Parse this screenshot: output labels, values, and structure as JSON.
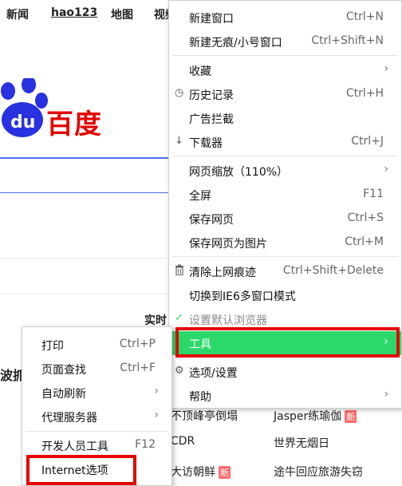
{
  "background": {
    "nav": [
      "新闻",
      "hao123",
      "地图",
      "视频"
    ],
    "logo_text": "百度",
    "logo_paw_text": "du",
    "realtime_label": "实时",
    "cut_text": "波抓",
    "hot_list": [
      {
        "left": "不顶峰亭倒塌",
        "right": "Jasper练瑜伽",
        "right_badge": "新"
      },
      {
        "left": "CDR",
        "right": "世界无烟日",
        "right_badge": ""
      },
      {
        "left": "大访朝鲜",
        "left_badge": "新",
        "right": "途牛回应旅游失窃",
        "right_badge": ""
      }
    ]
  },
  "main_menu": {
    "items": [
      {
        "label": "新建窗口",
        "shortcut": "Ctrl+N"
      },
      {
        "label": "新建无痕/小号窗口",
        "shortcut": "Ctrl+Shift+N"
      },
      {
        "label": "收藏",
        "arrow": "›"
      },
      {
        "label": "历史记录",
        "shortcut": "Ctrl+H",
        "icon": "clock-icon"
      },
      {
        "label": "广告拦截"
      },
      {
        "label": "下载器",
        "shortcut": "Ctrl+J",
        "icon": "download-arrow-icon"
      },
      {
        "label": "网页缩放（110%）",
        "arrow": "›"
      },
      {
        "label": "全屏",
        "shortcut": "F11"
      },
      {
        "label": "保存网页",
        "shortcut": "Ctrl+S"
      },
      {
        "label": "保存网页为图片",
        "shortcut": "Ctrl+M"
      },
      {
        "label": "清除上网痕迹",
        "shortcut": "Ctrl+Shift+Delete",
        "icon": "trash-icon"
      },
      {
        "label": "切换到IE6多窗口模式"
      },
      {
        "label": "设置默认浏览器",
        "icon": "check-icon"
      },
      {
        "label": "工具",
        "arrow": "›"
      },
      {
        "label": "选项/设置",
        "icon": "gear-icon"
      },
      {
        "label": "帮助",
        "arrow": "›"
      }
    ]
  },
  "tools_submenu": {
    "items": [
      {
        "label": "打印",
        "shortcut": "Ctrl+P"
      },
      {
        "label": "页面查找",
        "shortcut": "Ctrl+F"
      },
      {
        "label": "自动刷新",
        "arrow": "›"
      },
      {
        "label": "代理服务器",
        "arrow": "›"
      },
      {
        "label": "开发人员工具",
        "shortcut": "F12"
      },
      {
        "label": "Internet选项"
      }
    ]
  },
  "colors": {
    "highlight": "#2bd96b",
    "annotation_red": "#e60000",
    "baidu_red": "#e10602",
    "baidu_blue": "#2932e1"
  },
  "icons": {
    "check": "✓",
    "gear": "⚙",
    "download": "↓",
    "clock": "◷",
    "trash": "🗑"
  }
}
